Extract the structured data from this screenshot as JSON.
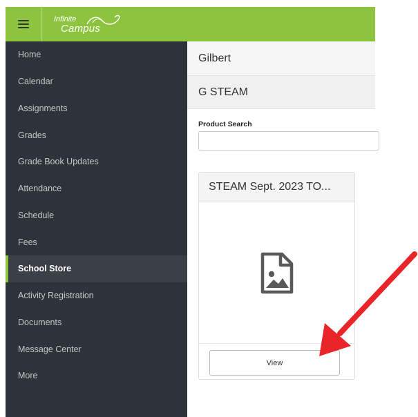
{
  "app": {
    "logo_line1": "Infinite",
    "logo_line2": "Campus",
    "brand_color": "#8dc43f"
  },
  "sidebar": {
    "items": [
      {
        "label": "Home",
        "active": false
      },
      {
        "label": "Calendar",
        "active": false
      },
      {
        "label": "Assignments",
        "active": false
      },
      {
        "label": "Grades",
        "active": false
      },
      {
        "label": "Grade Book Updates",
        "active": false
      },
      {
        "label": "Attendance",
        "active": false
      },
      {
        "label": "Schedule",
        "active": false
      },
      {
        "label": "Fees",
        "active": false
      },
      {
        "label": "School Store",
        "active": true
      },
      {
        "label": "Activity Registration",
        "active": false
      },
      {
        "label": "Documents",
        "active": false
      },
      {
        "label": "Message Center",
        "active": false
      },
      {
        "label": "More",
        "active": false
      }
    ]
  },
  "main": {
    "school_name": "Gilbert",
    "store_name": "G STEAM",
    "search": {
      "label": "Product Search",
      "value": "",
      "placeholder": ""
    },
    "product_card": {
      "title": "STEAM Sept. 2023 TO...",
      "image_icon": "image-placeholder-icon",
      "view_label": "View"
    }
  },
  "annotation": {
    "arrow_color": "#e8262a"
  }
}
